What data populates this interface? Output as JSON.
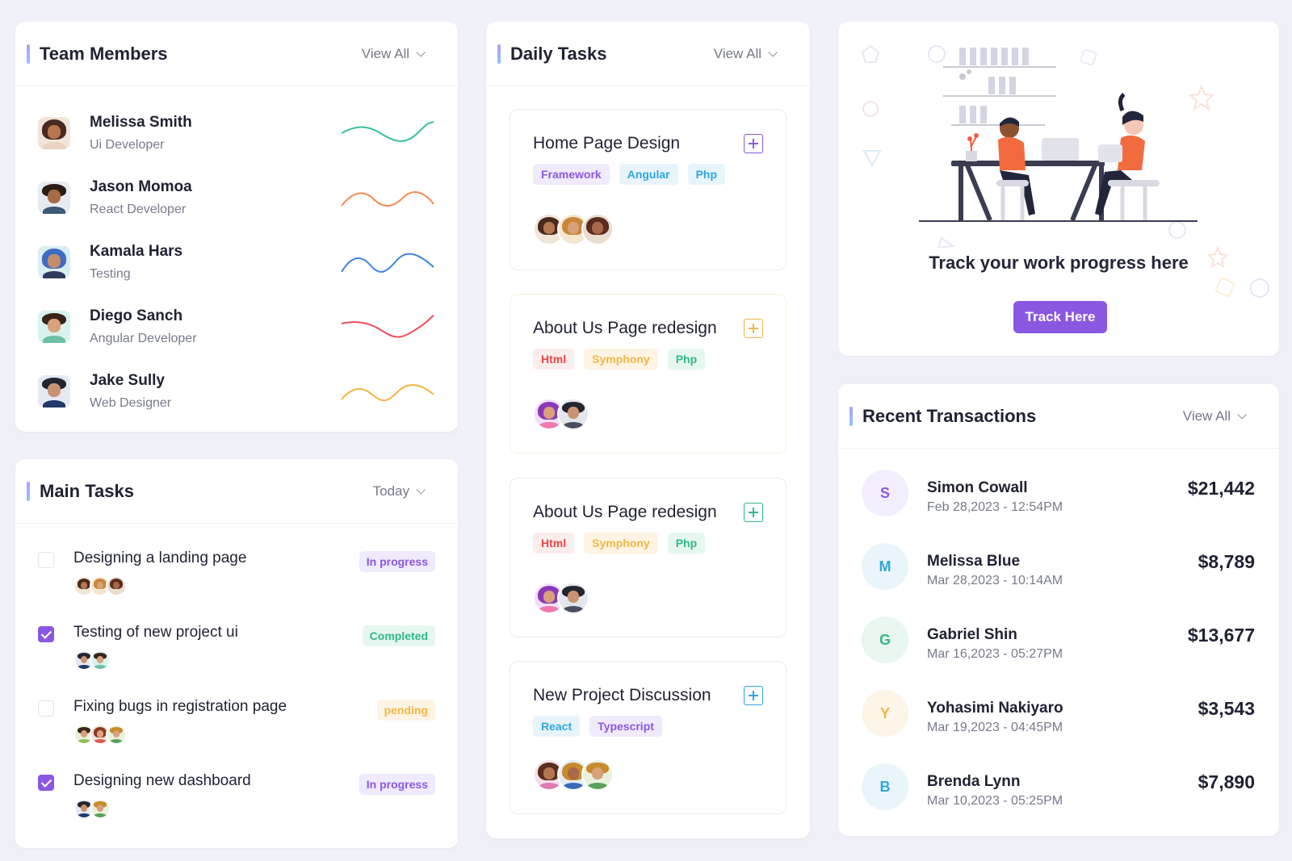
{
  "team": {
    "title": "Team Members",
    "view_all": "View All",
    "members": [
      {
        "name": "Melissa Smith",
        "role": "Ui Developer",
        "spark_color": "#3bbf9d"
      },
      {
        "name": "Jason Momoa",
        "role": "React Developer",
        "spark_color": "#f58d56"
      },
      {
        "name": "Kamala Hars",
        "role": "Testing",
        "spark_color": "#3f82e8"
      },
      {
        "name": "Diego Sanch",
        "role": "Angular Developer",
        "spark_color": "#ef4d5e"
      },
      {
        "name": "Jake Sully",
        "role": "Web Designer",
        "spark_color": "#f6b440"
      }
    ]
  },
  "main_tasks": {
    "title": "Main Tasks",
    "filter": "Today",
    "tasks": [
      {
        "title": "Designing a landing page",
        "status": "In progress",
        "checked": false
      },
      {
        "title": "Testing of new project ui",
        "status": "Completed",
        "checked": true
      },
      {
        "title": "Fixing bugs in registration page",
        "status": "pending",
        "checked": false
      },
      {
        "title": "Designing new dashboard",
        "status": "In progress",
        "checked": true
      }
    ]
  },
  "daily_tasks": {
    "title": "Daily Tasks",
    "view_all": "View All",
    "tasks": [
      {
        "title": "Home Page Design",
        "tags": [
          "Framework",
          "Angular",
          "Php"
        ],
        "accent": "#8a58e0"
      },
      {
        "title": "About Us Page redesign",
        "tags": [
          "Html",
          "Symphony",
          "Php"
        ],
        "accent": "#f1b648"
      },
      {
        "title": "About Us Page redesign",
        "tags": [
          "Html",
          "Symphony",
          "Php"
        ],
        "accent": "#2fb98a"
      },
      {
        "title": "New Project Discussion",
        "tags": [
          "React",
          "Typescript"
        ],
        "accent": "#2ea7e0"
      }
    ]
  },
  "promo": {
    "text": "Track your work progress here",
    "button": "Track Here"
  },
  "transactions": {
    "title": "Recent Transactions",
    "view_all": "View All",
    "items": [
      {
        "initial": "S",
        "name": "Simon Cowall",
        "datetime": "Feb 28,2023 - 12:54PM",
        "amount": "$21,442"
      },
      {
        "initial": "M",
        "name": "Melissa Blue",
        "datetime": "Mar 28,2023 - 10:14AM",
        "amount": "$8,789"
      },
      {
        "initial": "G",
        "name": "Gabriel Shin",
        "datetime": "Mar 16,2023 - 05:27PM",
        "amount": "$13,677"
      },
      {
        "initial": "Y",
        "name": "Yohasimi Nakiyaro",
        "datetime": "Mar 19,2023 - 04:45PM",
        "amount": "$3,543"
      },
      {
        "initial": "B",
        "name": "Brenda Lynn",
        "datetime": "Mar 10,2023 - 05:25PM",
        "amount": "$7,890"
      }
    ]
  }
}
